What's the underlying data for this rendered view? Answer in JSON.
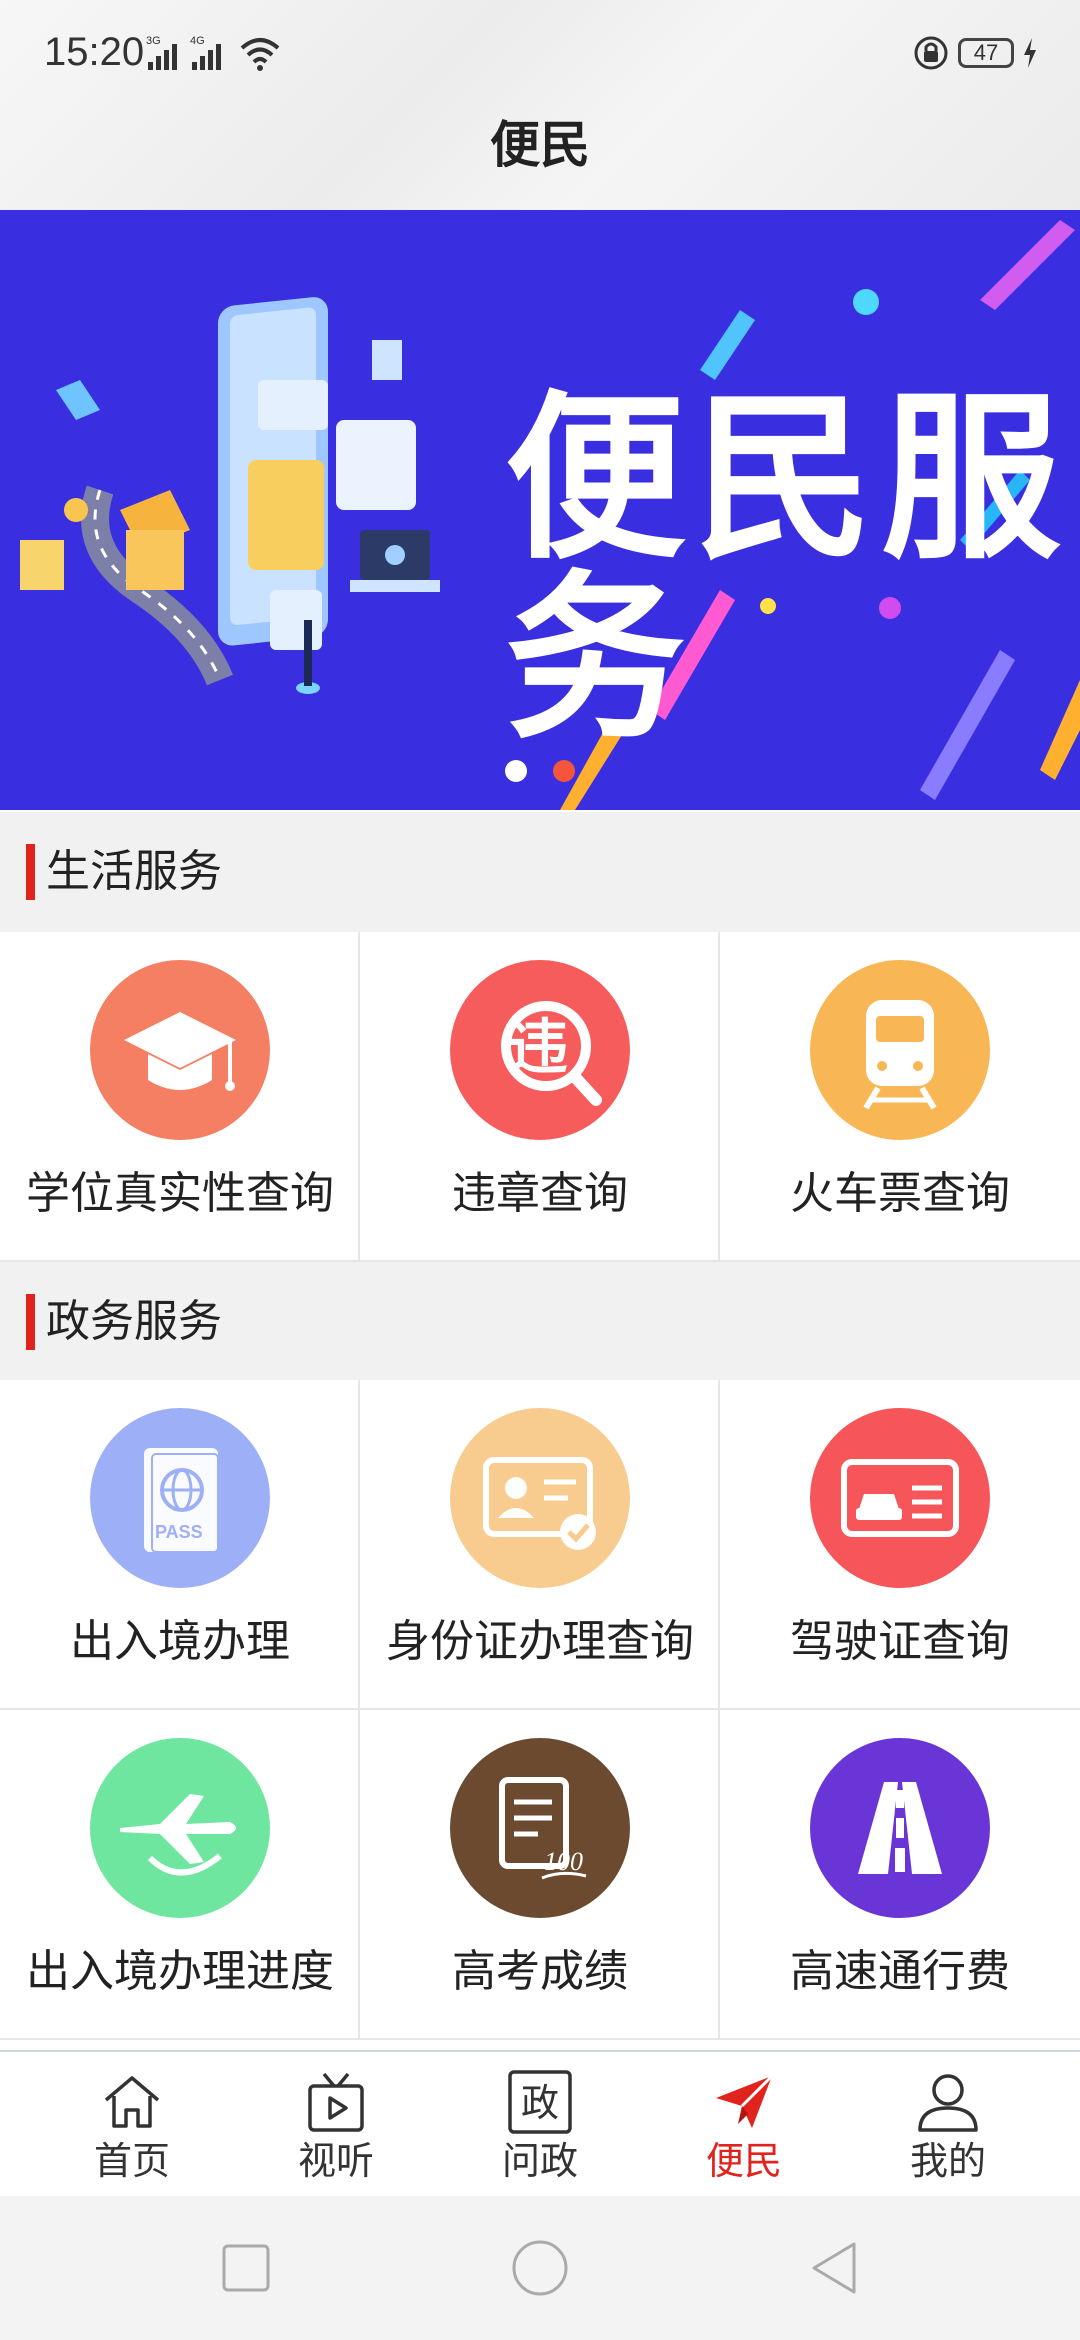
{
  "status_bar": {
    "time": "15:20",
    "network_1": "3G",
    "network_2": "4G",
    "battery": "47"
  },
  "header": {
    "title": "便民"
  },
  "banner": {
    "title": "便民服务",
    "background": "#3a2fe0",
    "page_dots": 2,
    "active_dot": 2
  },
  "life_services": {
    "title": "生活服务",
    "items": [
      {
        "label": "学位真实性查询",
        "icon": "graduation-cap-icon",
        "color": "#f47f62"
      },
      {
        "label": "违章查询",
        "icon": "violation-search-icon",
        "color": "#f75c5c"
      },
      {
        "label": "火车票查询",
        "icon": "train-icon",
        "color": "#f8b655"
      }
    ]
  },
  "gov_services": {
    "title": "政务服务",
    "items": [
      {
        "label": "出入境办理",
        "icon": "passport-icon",
        "color": "#9db0f7",
        "icon_text": "PASS"
      },
      {
        "label": "身份证办理查询",
        "icon": "id-card-icon",
        "color": "#f8cb8f"
      },
      {
        "label": "驾驶证查询",
        "icon": "driver-license-icon",
        "color": "#f6555a"
      },
      {
        "label": "出入境办理进度",
        "icon": "airplane-icon",
        "color": "#6fe69f"
      },
      {
        "label": "高考成绩",
        "icon": "exam-score-icon",
        "color": "#6b4a2f",
        "icon_text": "100"
      },
      {
        "label": "高速通行费",
        "icon": "highway-icon",
        "color": "#6a35d6"
      }
    ]
  },
  "tabs": [
    {
      "label": "首页",
      "icon": "home-icon"
    },
    {
      "label": "视听",
      "icon": "tv-icon"
    },
    {
      "label": "问政",
      "icon": "zheng-icon",
      "icon_text": "政"
    },
    {
      "label": "便民",
      "icon": "paper-plane-icon",
      "active": true
    },
    {
      "label": "我的",
      "icon": "user-icon"
    }
  ],
  "colors": {
    "accent": "#e0231c"
  }
}
